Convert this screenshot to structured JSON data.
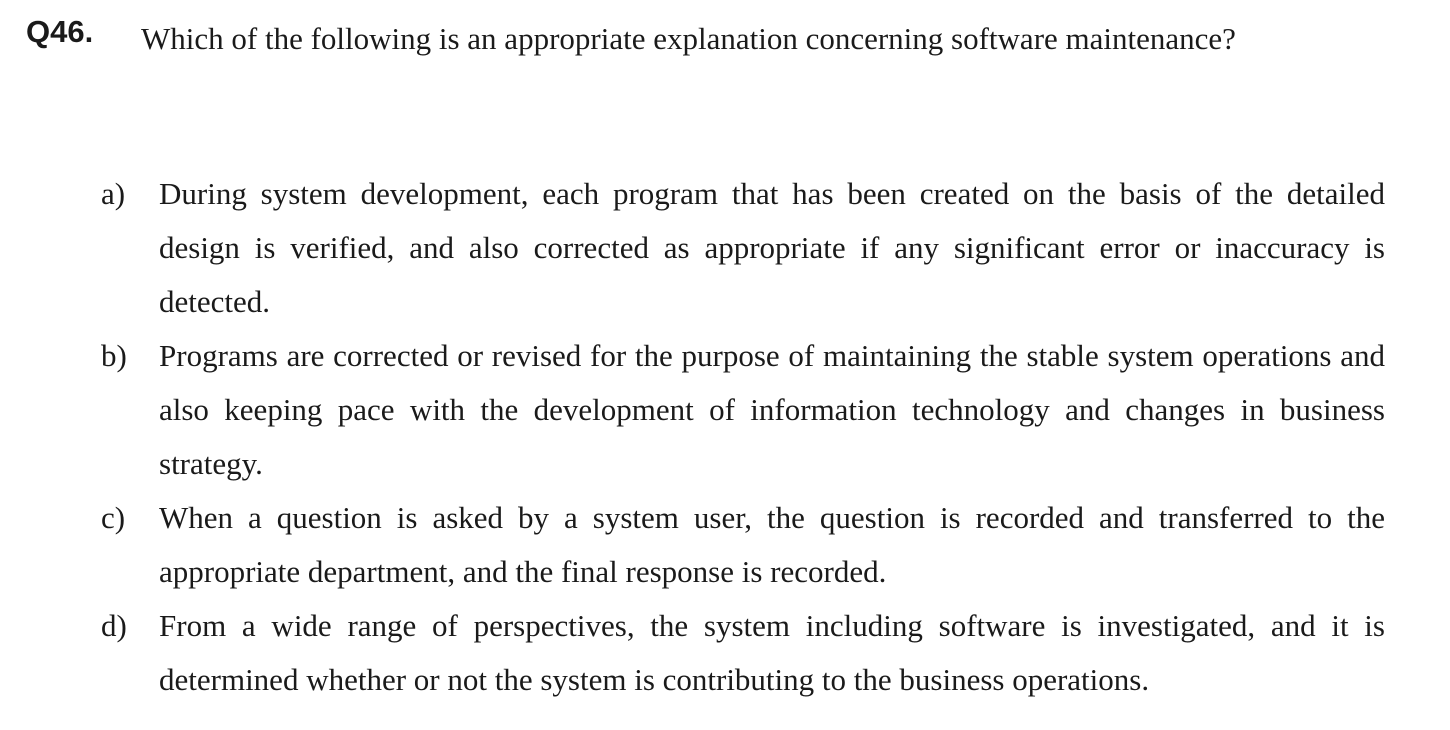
{
  "question": {
    "number": "Q46.",
    "text": "Which of the following is an appropriate explanation concerning software maintenance?"
  },
  "options": [
    {
      "label": "a)",
      "text": "During system development, each program that has been created on the basis of the detailed design is verified, and also corrected as appropriate if any significant error or inaccuracy is detected."
    },
    {
      "label": "b)",
      "text": "Programs are corrected or revised for the purpose of maintaining the stable system operations and also keeping pace with the development of information technology and changes in business strategy."
    },
    {
      "label": "c)",
      "text": "When a question is asked by a system user, the question is recorded and transferred to the appropriate department, and the final response is recorded."
    },
    {
      "label": "d)",
      "text": "From a wide range of perspectives, the system including software is investigated, and it is determined whether or not the system is contributing to the business operations."
    }
  ]
}
